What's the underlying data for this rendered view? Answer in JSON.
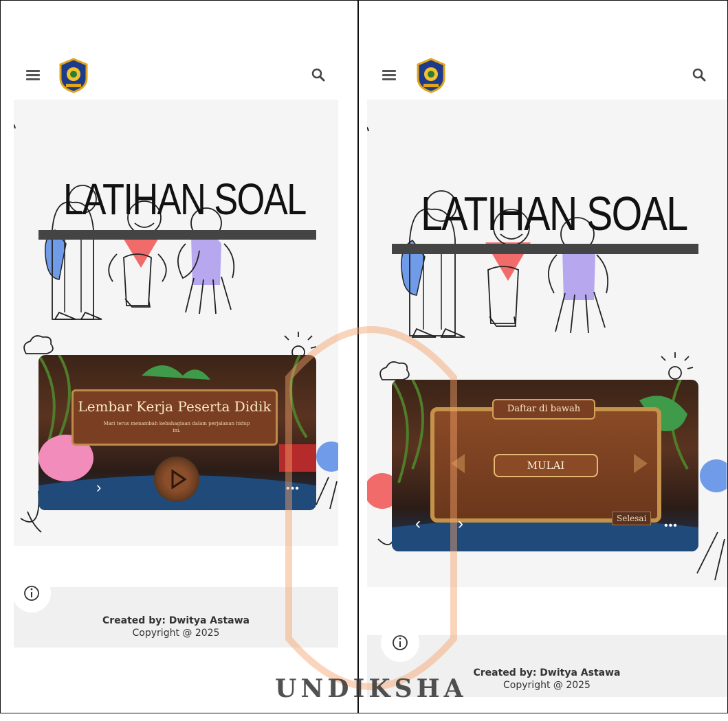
{
  "panels": [
    {
      "id": "left",
      "title": "LATIHAN SOAL",
      "game": {
        "banner_title": "Lembar Kerja Peserta Didik",
        "banner_subtitle": "Mari terus menambah kebahagiaan dalam perjalanan hidup ini.",
        "next_label": "›",
        "more_label": "•••"
      },
      "footer": {
        "created_by": "Created by: Dwitya Astawa",
        "copyright": "Copyright @ 2025"
      }
    },
    {
      "id": "right",
      "title": "LATIHAN SOAL",
      "game": {
        "header_label": "Daftar di bawah",
        "start_label": "MULAI",
        "finish_label": "Selesai",
        "prev_label": "‹",
        "next_label": "›",
        "more_label": "•••"
      },
      "footer": {
        "created_by": "Created by: Dwitya Astawa",
        "copyright": "Copyright @ 2025"
      }
    }
  ],
  "watermark_text": "UNDIKSHA",
  "colors": {
    "title_bar": "#444444",
    "blue_figure": "#6f9be8",
    "red_heart": "#f26b6b",
    "purple_figure": "#b7a7ef",
    "wood": "#7a3f22",
    "watermark": "#f4a26a"
  },
  "icons": [
    "menu-icon",
    "logo-crest-icon",
    "search-icon",
    "info-icon",
    "play-icon"
  ]
}
